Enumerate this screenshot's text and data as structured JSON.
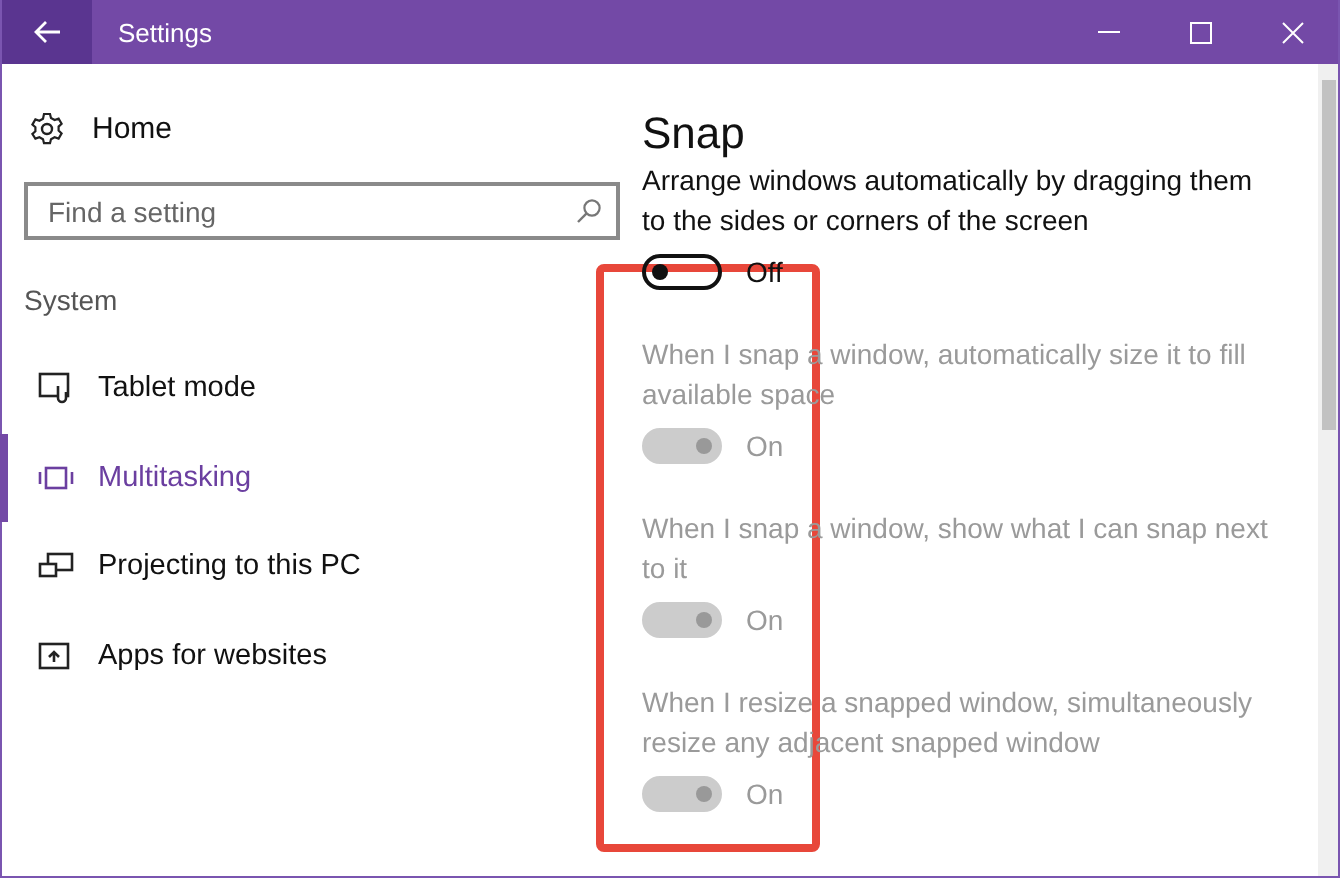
{
  "window": {
    "title": "Settings"
  },
  "sidebar": {
    "home": "Home",
    "search": {
      "placeholder": "Find a setting"
    },
    "section": "System",
    "items": [
      {
        "label": "Tablet mode",
        "selected": false
      },
      {
        "label": "Multitasking",
        "selected": true
      },
      {
        "label": "Projecting to this PC",
        "selected": false
      },
      {
        "label": "Apps for websites",
        "selected": false
      }
    ]
  },
  "content": {
    "heading": "Snap",
    "highlight": true,
    "settings": [
      {
        "label": "Arrange windows automatically by dragging them to the sides or corners of the screen",
        "on": false,
        "disabled": false,
        "state_text": "Off"
      },
      {
        "label": "When I snap a window, automatically size it to fill available space",
        "on": true,
        "disabled": true,
        "state_text": "On"
      },
      {
        "label": "When I snap a window, show what I can snap next to it",
        "on": true,
        "disabled": true,
        "state_text": "On"
      },
      {
        "label": "When I resize a snapped window, simultaneously resize any adjacent snapped window",
        "on": true,
        "disabled": true,
        "state_text": "On"
      }
    ]
  }
}
